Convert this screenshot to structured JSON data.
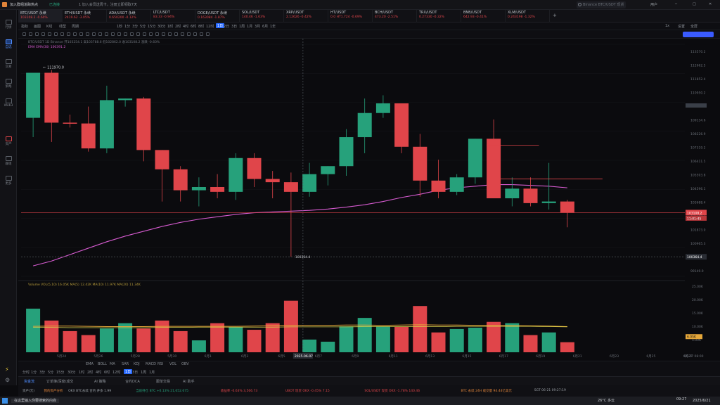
{
  "app": {
    "title": "加入群组追踪热点",
    "status": "已连接",
    "notice": "1 加入会员送周卡，注册立即领取7天",
    "search_placeholder": "Binance BTC/USDT 现货",
    "user": "用户"
  },
  "sidebar": {
    "items": [
      "行情",
      "自选",
      "交易",
      "策略",
      "Web3",
      "资产",
      "群组",
      "更多"
    ]
  },
  "tickers": [
    {
      "name": "BTC/USDT 永续",
      "price": "103108.2",
      "chg": "-0.60%",
      "dir": "dn",
      "active": true
    },
    {
      "name": "ETH/USDT 永续",
      "price": "2419.62",
      "chg": "-3.05%",
      "dir": "dn"
    },
    {
      "name": "ADA/USDT 永续",
      "price": "0.650200",
      "chg": "-0.12%",
      "dir": "dn"
    },
    {
      "name": "LTC/USDT",
      "price": "83.33",
      "chg": "-0.94%",
      "dir": "dn"
    },
    {
      "name": "DOGE/USDT 永续",
      "price": "0.163084",
      "chg": "-1.87%",
      "dir": "dn"
    },
    {
      "name": "SOL/USDT",
      "price": "140.46",
      "chg": "-1.63%",
      "dir": "dn"
    },
    {
      "name": "XRP/USDT",
      "price": "2.12626",
      "chg": "-0.42%",
      "dir": "dn"
    },
    {
      "name": "HT/USDT",
      "price": "0.0 HT1.724",
      "chg": "-0.69%",
      "dir": "dn"
    },
    {
      "name": "BCH/USDT",
      "price": "473.20",
      "chg": "-2.51%",
      "dir": "dn"
    },
    {
      "name": "TRX/USDT",
      "price": "0.27330",
      "chg": "-0.32%",
      "dir": "dn"
    },
    {
      "name": "BNB/USDT",
      "price": "642.93",
      "chg": "-0.41%",
      "dir": "dn"
    },
    {
      "name": "XLM/USDT",
      "price": "0.243198",
      "chg": "-1.32%",
      "dir": "dn"
    }
  ],
  "toolbar": {
    "left": [
      "指标",
      "画图",
      "K线",
      "线型",
      "周期"
    ],
    "timeframes": [
      "1秒",
      "1分",
      "3分",
      "5分",
      "15分",
      "30分",
      "1时",
      "2时",
      "4时",
      "6时",
      "8时",
      "12时",
      "1日",
      "2日",
      "3日",
      "1周",
      "1月",
      "3月",
      "6月",
      "1年"
    ],
    "active_tf": "1日",
    "right": [
      "1x",
      "设置",
      "全屏"
    ]
  },
  "legend": {
    "line1": "BTC/USDT 1D Binance  开103254.1  高103788.6  低102862.0  收103108.2  涨跌 -0.60%",
    "ema": "EMA  EMA(30)  100391.2",
    "high_label": "111970.0",
    "low_label": "100364.4",
    "cross_date": "2025-06-07",
    "volume_legend": "Volume  VOL(5,10)  16.05K  MA(5) 12.42K  MA(10) 11.97K  MA(20) 11.34K"
  },
  "price_axis": {
    "ticks": [
      "113570.2",
      "112662.5",
      "111852.4",
      "110950.2",
      "110042.5",
      "109134.6",
      "108226.9",
      "107319.2",
      "106411.5",
      "105503.8",
      "104596.1",
      "103688.4",
      "102780.7",
      "101873.0",
      "100965.3",
      "100057.6",
      "99149.9"
    ],
    "current": "103108.2",
    "countdown": "11:01:45",
    "crosshair": "100364.4"
  },
  "vol_axis": {
    "ticks": [
      "25.00K",
      "20.00K",
      "15.00K",
      "10.00K",
      "5.00K"
    ],
    "current": "6.05K"
  },
  "date_axis": {
    "ticks": [
      "5月24",
      "5月26",
      "5月28",
      "5月30",
      "6月1",
      "6月3",
      "6月5",
      "6月7",
      "6月9",
      "6月11",
      "6月13",
      "6月15",
      "6月17",
      "6月19",
      "6月21",
      "6月23",
      "6月25",
      "6月27"
    ],
    "crosshair": "2025-06-07",
    "right": "06-27 08:00"
  },
  "chart_data": {
    "type": "candlestick",
    "ylim": [
      99149.9,
      113570.2
    ],
    "candles": [
      {
        "o": 109000,
        "h": 110500,
        "l": 107800,
        "c": 111800
      },
      {
        "o": 111800,
        "h": 111970,
        "l": 107500,
        "c": 108700
      },
      {
        "o": 108700,
        "h": 109200,
        "l": 108400,
        "c": 108650
      },
      {
        "o": 108650,
        "h": 109700,
        "l": 106900,
        "c": 107100
      },
      {
        "o": 107100,
        "h": 111000,
        "l": 106800,
        "c": 110100
      },
      {
        "o": 110100,
        "h": 110200,
        "l": 109700,
        "c": 110200
      },
      {
        "o": 110200,
        "h": 110300,
        "l": 106300,
        "c": 107000
      },
      {
        "o": 107000,
        "h": 107000,
        "l": 103800,
        "c": 105800
      },
      {
        "o": 105800,
        "h": 106000,
        "l": 103800,
        "c": 104500
      },
      {
        "o": 104500,
        "h": 105300,
        "l": 103500,
        "c": 104700
      },
      {
        "o": 104700,
        "h": 105500,
        "l": 104000,
        "c": 104400
      },
      {
        "o": 104400,
        "h": 106800,
        "l": 103900,
        "c": 106500
      },
      {
        "o": 106500,
        "h": 106800,
        "l": 104700,
        "c": 105200
      },
      {
        "o": 105200,
        "h": 105700,
        "l": 104000,
        "c": 105000
      },
      {
        "o": 105000,
        "h": 105600,
        "l": 100364,
        "c": 104400
      },
      {
        "o": 104400,
        "h": 106200,
        "l": 104100,
        "c": 105500
      },
      {
        "o": 105500,
        "h": 106000,
        "l": 104800,
        "c": 106000
      },
      {
        "o": 106000,
        "h": 108300,
        "l": 105400,
        "c": 107800
      },
      {
        "o": 107800,
        "h": 110200,
        "l": 106800,
        "c": 109300
      },
      {
        "o": 109300,
        "h": 110400,
        "l": 109000,
        "c": 109900
      },
      {
        "o": 109900,
        "h": 109900,
        "l": 106800,
        "c": 107200
      },
      {
        "o": 107200,
        "h": 108000,
        "l": 104100,
        "c": 105100
      },
      {
        "o": 105100,
        "h": 106400,
        "l": 104000,
        "c": 104400
      },
      {
        "o": 104400,
        "h": 105500,
        "l": 104200,
        "c": 105300
      },
      {
        "o": 105300,
        "h": 107700,
        "l": 104900,
        "c": 107700
      },
      {
        "o": 107700,
        "h": 108900,
        "l": 104000,
        "c": 104000
      },
      {
        "o": 104000,
        "h": 105300,
        "l": 103500,
        "c": 104600
      },
      {
        "o": 104600,
        "h": 105300,
        "l": 103500,
        "c": 103700
      },
      {
        "o": 103700,
        "h": 106200,
        "l": 103300,
        "c": 103800
      },
      {
        "o": 103800,
        "h": 103900,
        "l": 102200,
        "c": 103100
      }
    ],
    "ema": [
      99800,
      100100,
      100500,
      100900,
      101300,
      101650,
      101950,
      102250,
      102500,
      102700,
      102850,
      103000,
      103100,
      103150,
      103200,
      103250,
      103330,
      103450,
      103600,
      103800,
      104050,
      104250,
      104500,
      104650,
      104750,
      104850,
      104850,
      104800,
      104750,
      104650
    ],
    "volume": [
      16.5,
      12,
      8,
      6.5,
      9,
      11,
      9,
      12,
      8,
      4.5,
      11,
      9.5,
      8.5,
      11,
      19.5,
      4.8,
      4,
      9.8,
      13,
      9.8,
      9.6,
      17.5,
      7.5,
      8.8,
      9.3,
      11.5,
      11,
      6.5,
      7.5,
      3.8
    ],
    "vol_ma": [
      9.8,
      9.9,
      9.9,
      9.8,
      9.7,
      9.7,
      9.7,
      9.8,
      9.8,
      9.8,
      9.8,
      9.8,
      9.9,
      10,
      10.2,
      10.2,
      10.2,
      10.3,
      10.3,
      10.2,
      10.3,
      10.4,
      10.3,
      10.3,
      10.2,
      10.2,
      10.1,
      10,
      9.9,
      9.7
    ],
    "vol_ma2": [
      9.4,
      9.4,
      9.3,
      9.3,
      9.3,
      9.3,
      9.3,
      9.4,
      9.4,
      9.5,
      9.5,
      9.5,
      9.5,
      9.5,
      9.6,
      9.6,
      9.6,
      9.6,
      9.7,
      9.7,
      9.7,
      9.7,
      9.7,
      9.8,
      9.8,
      9.8,
      9.8,
      9.8,
      9.7,
      9.6
    ],
    "vol_ylim": [
      0,
      25
    ]
  },
  "bottom_tf": {
    "labels": [
      "分时",
      "1分",
      "3分",
      "5分",
      "15分",
      "30分",
      "1时",
      "2时",
      "4时",
      "6时",
      "12时",
      "1日",
      "3日",
      "1周",
      "1月"
    ],
    "active": "1日",
    "indicators": [
      "EMA",
      "BOLL",
      "MA",
      "SAR",
      "KDJ",
      "MACD",
      "RSI",
      "VOL",
      "OBV"
    ]
  },
  "bottom_tabs": [
    "资金流",
    "订单簿/深度/成交",
    "AI 策略",
    "合约DCA",
    "跟单交易",
    "AI 助手"
  ],
  "status_bar": [
    {
      "t": "资产(元)",
      "c": "#9aa0a6"
    },
    {
      "t": "我的资产分析",
      "c": "#e0843a"
    },
    {
      "t": "OKX BTC永续 合约  开多 1.99",
      "c": "#9aa0a6"
    },
    {
      "t": "当前持仓 BTC +0.13%  21,652.675",
      "c": "#26a17b"
    },
    {
      "t": "收益率 -0.63%  3,566.73",
      "c": "#e0454a"
    },
    {
      "t": "UBOT 现货 OKX  -0.45%  7.15",
      "c": "#e0454a"
    },
    {
      "t": "SOL/USDT 现货 OKX  -1.78%  140.46",
      "c": "#e0454a"
    },
    {
      "t": "BTC 永续 24H 成交量 94.44亿美元",
      "c": "#e0843a"
    },
    {
      "t": "SGT 06-21 09:27:19",
      "c": "#9aa0a6"
    }
  ],
  "taskbar": {
    "search": "在这里输入你要搜索的内容",
    "weather": "26°C 多云",
    "time": "09:27",
    "date": "2025/6/21"
  }
}
